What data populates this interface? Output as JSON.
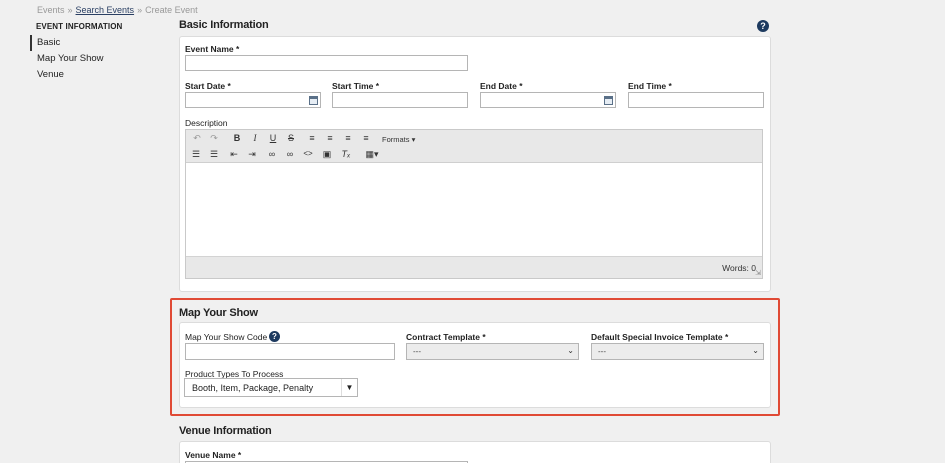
{
  "breadcrumb": {
    "item1": "Events",
    "sep1": "»",
    "item2": "Search Events",
    "sep2": "»",
    "item3": "Create Event"
  },
  "sidebar": {
    "heading": "EVENT INFORMATION",
    "items": [
      {
        "label": "Basic",
        "active": true
      },
      {
        "label": "Map Your Show"
      },
      {
        "label": "Venue"
      }
    ]
  },
  "basic": {
    "title": "Basic Information",
    "help_symbol": "?",
    "event_name_label": "Event Name *",
    "start_date_label": "Start Date *",
    "start_time_label": "Start Time *",
    "end_date_label": "End Date *",
    "end_time_label": "End Time *",
    "description_label": "Description",
    "formats_label": "Formats",
    "words": "Words: 0"
  },
  "map_your_show": {
    "title": "Map Your Show",
    "code_label": "Map Your Show Code",
    "help_symbol": "?",
    "contract_label": "Contract Template *",
    "contract_value": "---",
    "invoice_label": "Default Special Invoice Template *",
    "invoice_value": "---",
    "product_types_label": "Product Types To Process",
    "product_types_value": "Booth, Item, Package, Penalty"
  },
  "venue": {
    "title": "Venue Information",
    "venue_name_label": "Venue Name *"
  },
  "colors": {
    "highlight": "#e04a35",
    "help_badge": "#1d3a5f",
    "link": "#2a3f63"
  },
  "icons": [
    "help-icon",
    "calendar-icon",
    "undo-icon",
    "redo-icon",
    "bold-icon",
    "italic-icon",
    "underline-icon",
    "strikethrough-icon",
    "align-left-icon",
    "align-center-icon",
    "align-right-icon",
    "justify-icon",
    "bullet-list-icon",
    "numbered-list-icon",
    "outdent-icon",
    "indent-icon",
    "link-icon",
    "unlink-icon",
    "code-icon",
    "image-icon",
    "clear-format-icon",
    "table-icon",
    "chevron-down-icon",
    "resize-grip-icon"
  ]
}
